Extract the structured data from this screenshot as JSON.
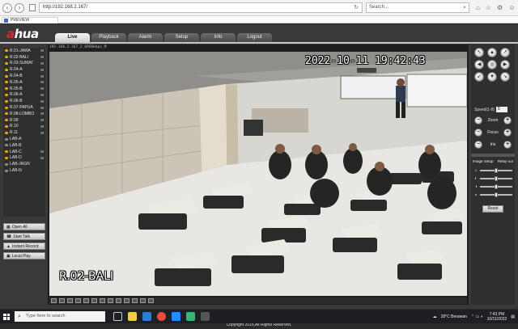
{
  "browser": {
    "address": "http://192.168.2.167/",
    "search_placeholder": "Search...",
    "tab_title": "PREVIEW"
  },
  "app": {
    "logo": "alhua",
    "tabs": [
      "Live",
      "Playback",
      "Alarm",
      "Setup",
      "Info",
      "Logout"
    ],
    "active_tab": "Live",
    "footer": "Copyright 2015,All Rights Reserved."
  },
  "channels": [
    {
      "name": "R.01-JAWA",
      "m": "M",
      "active": true
    },
    {
      "name": "R.02-BALI",
      "m": "M",
      "active": true
    },
    {
      "name": "R.03-SUMAT",
      "m": "M",
      "active": true
    },
    {
      "name": "R.04-A",
      "m": "M",
      "active": true
    },
    {
      "name": "R.04-B",
      "m": "M",
      "active": true
    },
    {
      "name": "R.05-A",
      "m": "M",
      "active": true
    },
    {
      "name": "R.05-B",
      "m": "M",
      "active": true
    },
    {
      "name": "R.06-A",
      "m": "M",
      "active": true
    },
    {
      "name": "R.06-B",
      "m": "M",
      "active": true
    },
    {
      "name": "R.07-PAPUA",
      "m": "M",
      "active": true
    },
    {
      "name": "R.08-LOMBO",
      "m": "M",
      "active": true
    },
    {
      "name": "R.09",
      "m": "M",
      "active": true
    },
    {
      "name": "R.10",
      "m": "M",
      "active": true
    },
    {
      "name": "R.11",
      "m": "M",
      "active": true
    },
    {
      "name": "LAB-A",
      "m": "",
      "active": false
    },
    {
      "name": "LAB-B",
      "m": "",
      "active": false
    },
    {
      "name": "LAB-C",
      "m": "M",
      "active": true
    },
    {
      "name": "LAB-D",
      "m": "M",
      "active": true
    },
    {
      "name": "LAB-JRGN",
      "m": "",
      "active": false
    },
    {
      "name": "LAB-N",
      "m": "",
      "active": false
    }
  ],
  "left_buttons": [
    {
      "icon": "grid-icon",
      "label": "Open All"
    },
    {
      "icon": "talk-icon",
      "label": "Start Talk"
    },
    {
      "icon": "record-icon",
      "label": "Instant Record"
    },
    {
      "icon": "play-icon",
      "label": "Local Play"
    }
  ],
  "video": {
    "title": "192.168.2.167_2_6966kbps_M",
    "osd_time": "2022-10-11 19:42:43",
    "osd_name": "R.02-BALI"
  },
  "ptz": {
    "speed_label": "Speed(1-8)",
    "speed_value": "5",
    "controls": [
      {
        "label": "Zoom"
      },
      {
        "label": "Focus"
      },
      {
        "label": "Iris"
      }
    ],
    "image_setup_label": "Image Setup",
    "relay_label": "Relay-out",
    "reset_label": "Reset",
    "sliders": [
      {
        "icon": "brightness-icon",
        "level": 0.5
      },
      {
        "icon": "contrast-icon",
        "level": 0.5
      },
      {
        "icon": "saturation-icon",
        "level": 0.5
      },
      {
        "icon": "hue-icon",
        "level": 0.5
      }
    ]
  },
  "taskbar": {
    "search_placeholder": "Type here to search",
    "weather": "28°C  Berawan",
    "time": "7:43 PM",
    "date": "10/11/2022"
  }
}
